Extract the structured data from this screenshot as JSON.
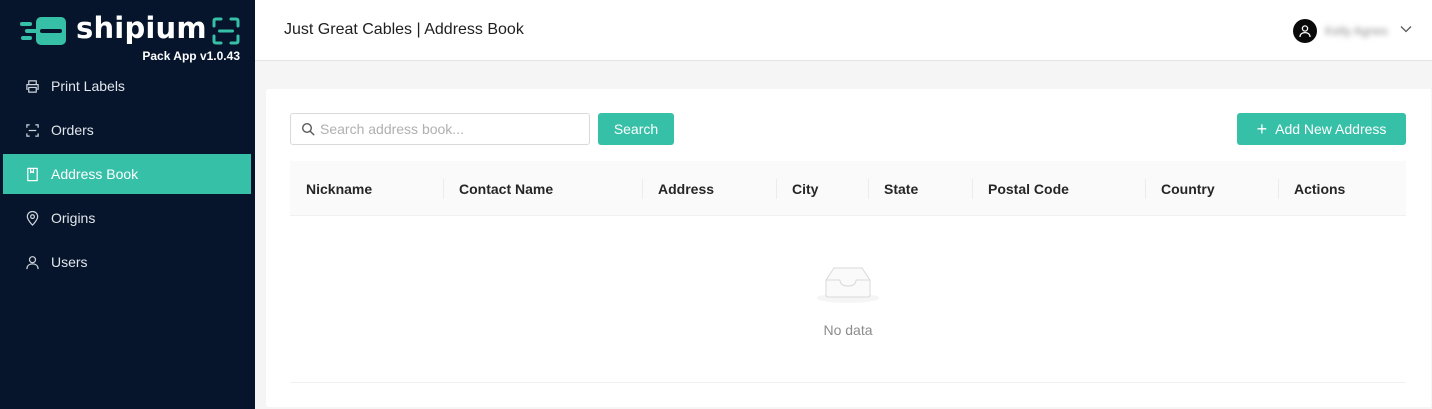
{
  "brand": {
    "name": "shipium",
    "version": "Pack App v1.0.43",
    "accent": "#37c0a8",
    "sidebar_bg": "#06152b"
  },
  "sidebar": {
    "items": [
      {
        "label": "Print Labels",
        "icon": "printer-icon",
        "active": false
      },
      {
        "label": "Orders",
        "icon": "scan-icon",
        "active": false
      },
      {
        "label": "Address Book",
        "icon": "book-icon",
        "active": true
      },
      {
        "label": "Origins",
        "icon": "location-pin-icon",
        "active": false
      },
      {
        "label": "Users",
        "icon": "user-icon",
        "active": false
      }
    ]
  },
  "header": {
    "title": "Just Great Cables | Address Book",
    "user_name": "Kelly Agnes",
    "user_icon": "user-avatar-icon",
    "menu_icon": "chevron-down-icon"
  },
  "toolbar": {
    "search_placeholder": "Search address book...",
    "search_value": "",
    "search_label": "Search",
    "add_label": "Add New Address"
  },
  "table": {
    "columns": [
      "Nickname",
      "Contact Name",
      "Address",
      "City",
      "State",
      "Postal Code",
      "Country",
      "Actions"
    ],
    "rows": [],
    "empty_text": "No data"
  }
}
